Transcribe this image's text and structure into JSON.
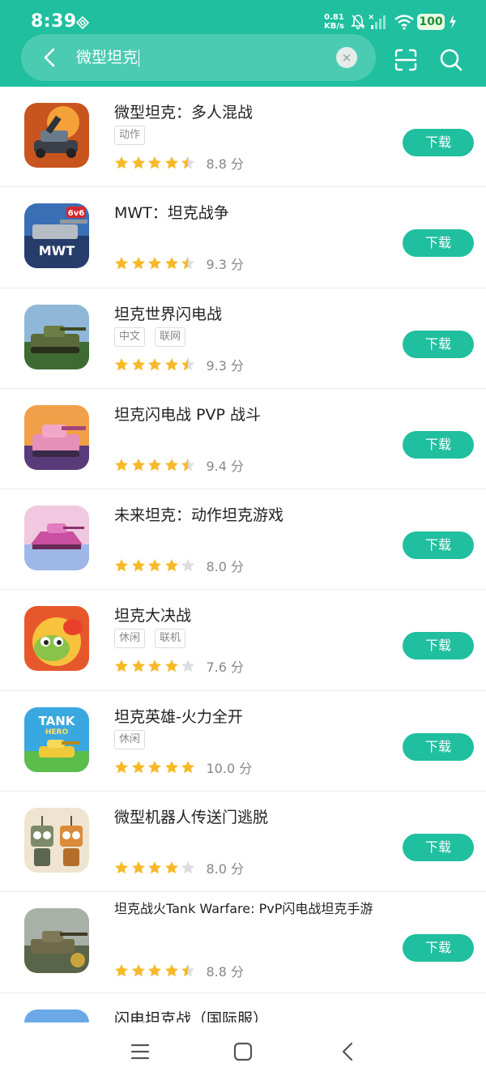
{
  "status_bar": {
    "time": "8:39",
    "speed_value": "0.81",
    "speed_unit": "KB/s",
    "battery": "100"
  },
  "search": {
    "query": "微型坦克",
    "clear_glyph": "×"
  },
  "colors": {
    "brand": "#1fbf9f",
    "star": "#f7b928",
    "star_empty": "#dddddd"
  },
  "results": [
    {
      "name": "微型坦克：多人混战",
      "tags": [
        "动作"
      ],
      "stars": 4.5,
      "score": "8.8 分",
      "button": "下载",
      "icon": "tank-battle-icon"
    },
    {
      "name": "MWT：坦克战争",
      "tags": [],
      "stars": 4.5,
      "score": "9.3 分",
      "button": "下载",
      "icon": "mwt-tank-icon"
    },
    {
      "name": "坦克世界闪电战",
      "tags": [
        "中文",
        "联网"
      ],
      "stars": 4.5,
      "score": "9.3 分",
      "button": "下载",
      "icon": "world-of-tanks-icon"
    },
    {
      "name": "坦克闪电战 PVP 战斗",
      "tags": [],
      "stars": 4.5,
      "score": "9.4 分",
      "button": "下载",
      "icon": "pink-tank-icon"
    },
    {
      "name": "未来坦克：动作坦克游戏",
      "tags": [],
      "stars": 4,
      "score": "8.0 分",
      "button": "下载",
      "icon": "future-tank-icon"
    },
    {
      "name": "坦克大决战",
      "tags": [
        "休闲",
        "联机"
      ],
      "stars": 4,
      "score": "7.6 分",
      "button": "下载",
      "icon": "frog-tank-icon"
    },
    {
      "name": "坦克英雄-火力全开",
      "tags": [
        "休闲"
      ],
      "stars": 5,
      "score": "10.0 分",
      "button": "下载",
      "icon": "tank-hero-icon"
    },
    {
      "name": "微型机器人传送门逃脱",
      "tags": [],
      "stars": 4,
      "score": "8.0 分",
      "button": "下载",
      "icon": "robots-icon"
    },
    {
      "name": "坦克战火Tank Warfare: PvP闪电战坦克手游",
      "tags": [],
      "stars": 4.5,
      "score": "8.8 分",
      "button": "下载",
      "icon": "tank-warfare-icon",
      "two_line": true
    },
    {
      "name": "闪电坦克战（国际服）",
      "tags": [],
      "stars": 0,
      "score": "",
      "button": "",
      "icon": "lightning-tank-icon",
      "partial": true
    }
  ]
}
